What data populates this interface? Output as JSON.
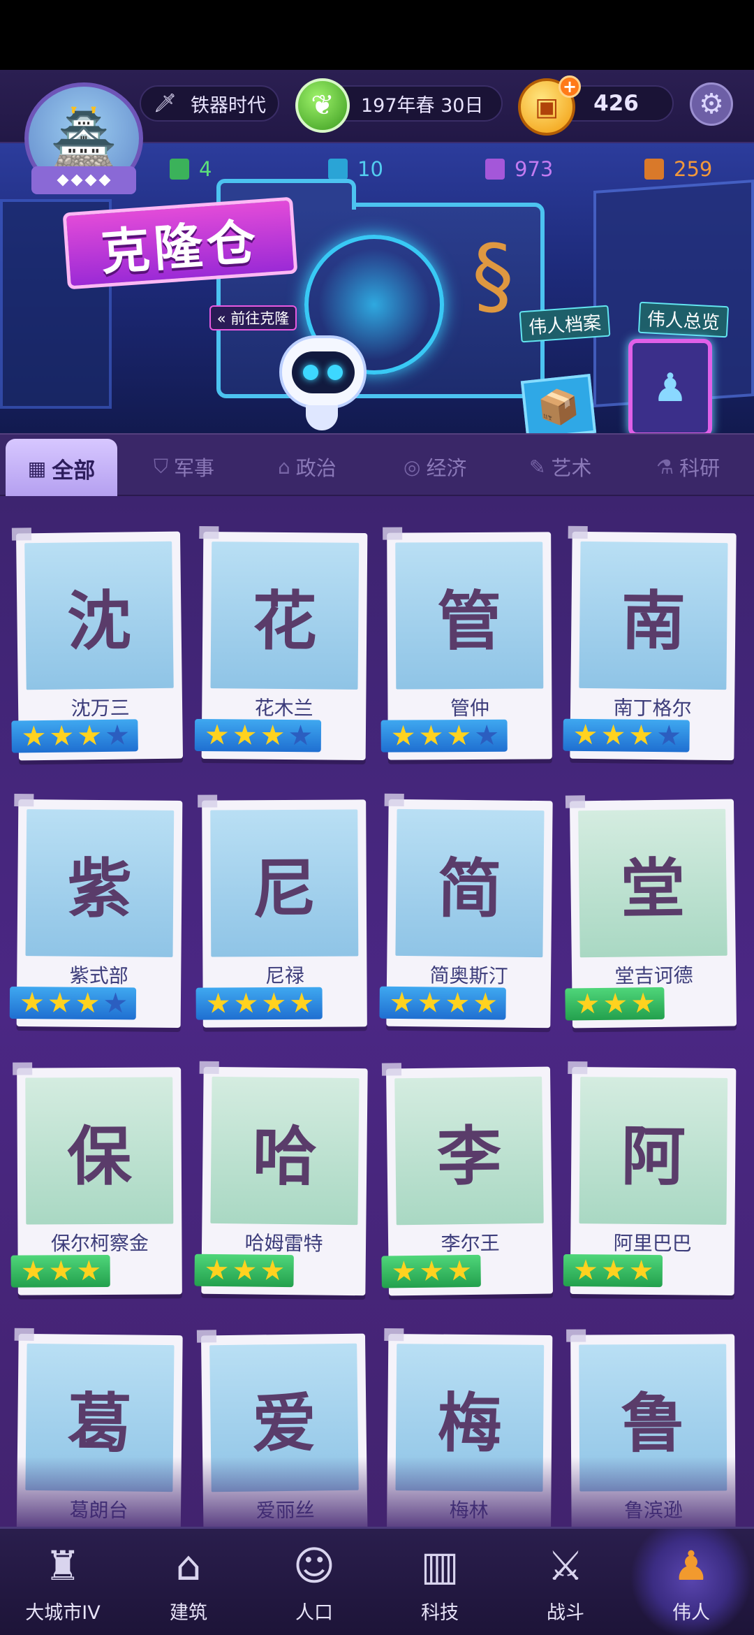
{
  "hud": {
    "era_label": "铁器时代",
    "date_label": "197年春  30日",
    "coins": "426",
    "add_symbol": "+"
  },
  "resources": [
    {
      "value": "4",
      "color": "#5ce07a"
    },
    {
      "value": "10",
      "color": "#53cdf0"
    },
    {
      "value": "973",
      "color": "#c27bf0"
    },
    {
      "value": "259",
      "color": "#f2983a"
    }
  ],
  "banner": {
    "title": "克隆仓",
    "goto_clone": "« 前往克隆",
    "profiles_label": "伟人档案",
    "overview_label": "伟人总览"
  },
  "tabs": [
    {
      "label": "全部",
      "icon": "grid-icon",
      "active": true
    },
    {
      "label": "军事",
      "icon": "shield-icon",
      "active": false
    },
    {
      "label": "政治",
      "icon": "capitol-icon",
      "active": false
    },
    {
      "label": "经济",
      "icon": "coins-icon",
      "active": false
    },
    {
      "label": "艺术",
      "icon": "palette-icon",
      "active": false
    },
    {
      "label": "科研",
      "icon": "flask-icon",
      "active": false
    }
  ],
  "greats": [
    {
      "name": "沈万三",
      "stars": 3,
      "max": 4,
      "badge": "blue"
    },
    {
      "name": "花木兰",
      "stars": 3,
      "max": 4,
      "badge": "blue"
    },
    {
      "name": "管仲",
      "stars": 3,
      "max": 4,
      "badge": "blue"
    },
    {
      "name": "南丁格尔",
      "stars": 3,
      "max": 4,
      "badge": "blue"
    },
    {
      "name": "紫式部",
      "stars": 3,
      "max": 4,
      "badge": "blue"
    },
    {
      "name": "尼禄",
      "stars": 4,
      "max": 4,
      "badge": "blue"
    },
    {
      "name": "简奥斯汀",
      "stars": 4,
      "max": 4,
      "badge": "blue"
    },
    {
      "name": "堂吉诃德",
      "stars": 3,
      "max": 3,
      "badge": "green"
    },
    {
      "name": "保尔柯察金",
      "stars": 3,
      "max": 3,
      "badge": "green"
    },
    {
      "name": "哈姆雷特",
      "stars": 3,
      "max": 3,
      "badge": "green"
    },
    {
      "name": "李尔王",
      "stars": 3,
      "max": 3,
      "badge": "green"
    },
    {
      "name": "阿里巴巴",
      "stars": 3,
      "max": 3,
      "badge": "green"
    },
    {
      "name": "葛朗台",
      "stars": 0,
      "max": 0,
      "badge": "none"
    },
    {
      "name": "爱丽丝",
      "stars": 0,
      "max": 0,
      "badge": "none"
    },
    {
      "name": "梅林",
      "stars": 0,
      "max": 0,
      "badge": "none"
    },
    {
      "name": "鲁滨逊",
      "stars": 0,
      "max": 0,
      "badge": "none"
    }
  ],
  "bottom_nav": [
    {
      "label": "大城市IV",
      "icon": "castle-icon",
      "active": false
    },
    {
      "label": "建筑",
      "icon": "house-icon",
      "active": false
    },
    {
      "label": "人口",
      "icon": "person-icon",
      "active": false
    },
    {
      "label": "科技",
      "icon": "book-icon",
      "active": false
    },
    {
      "label": "战斗",
      "icon": "swords-icon",
      "active": false
    },
    {
      "label": "伟人",
      "icon": "statue-icon",
      "active": true
    }
  ]
}
